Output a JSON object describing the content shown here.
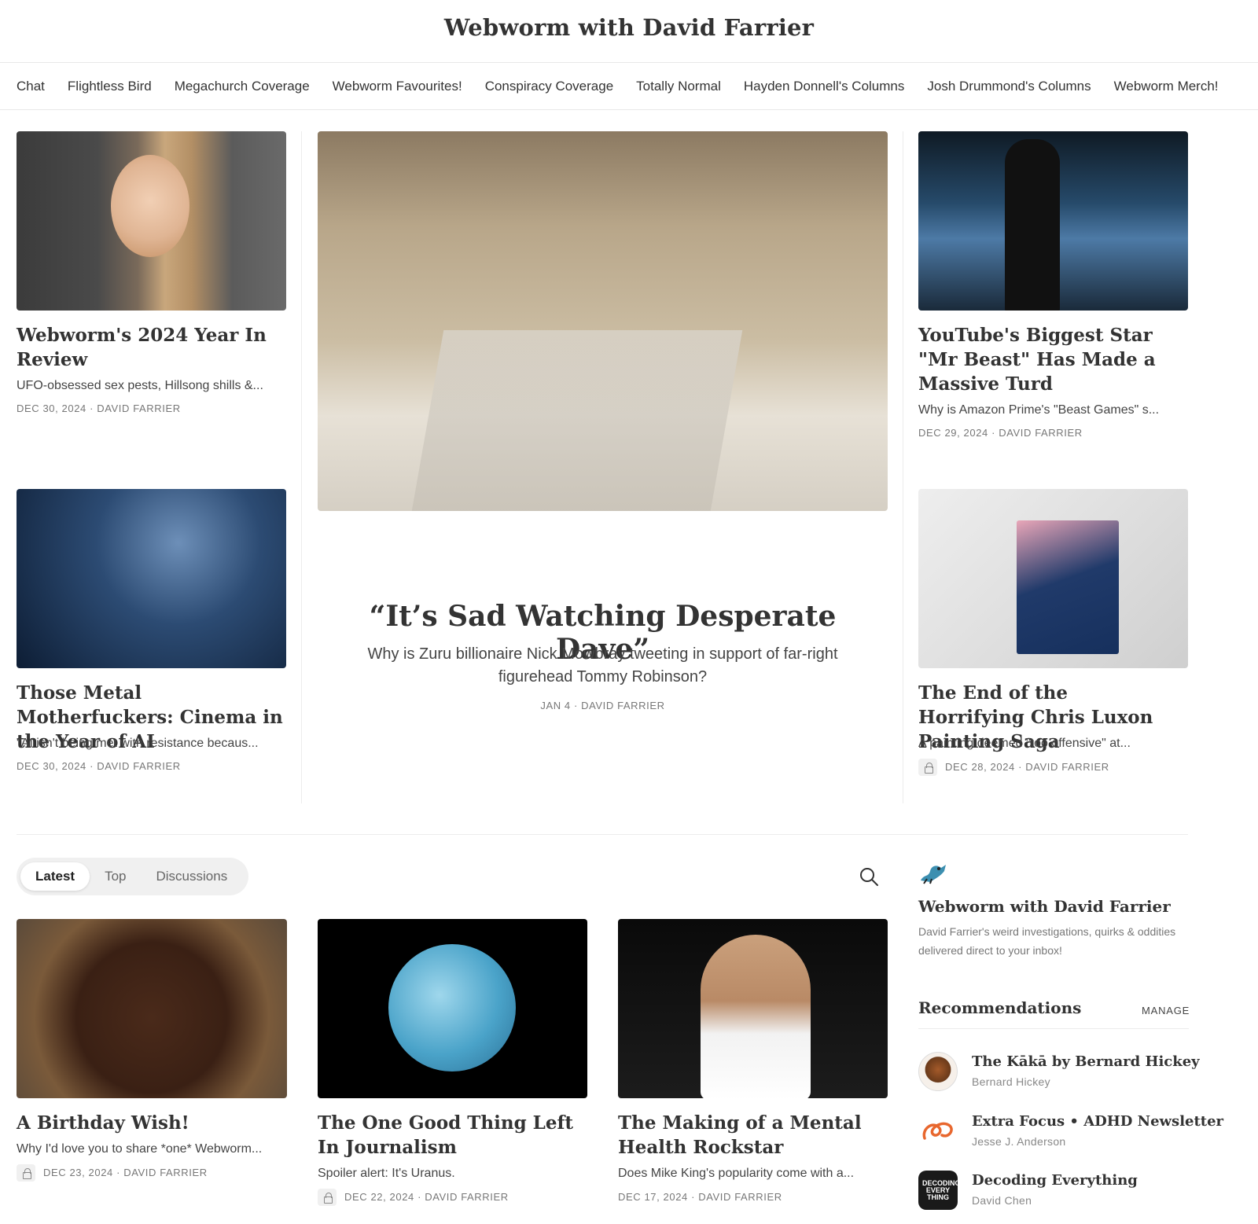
{
  "site": {
    "title": "Webworm with David Farrier"
  },
  "nav": [
    "Chat",
    "Flightless Bird",
    "Megachurch Coverage",
    "Webworm Favourites!",
    "Conspiracy Coverage",
    "Totally Normal",
    "Hayden Donnell's Columns",
    "Josh Drummond's Columns",
    "Webworm Merch!"
  ],
  "featured": {
    "left_top": {
      "title": "Webworm's 2024 Year In Review",
      "subtitle": "UFO-obsessed sex pests, Hillsong shills &...",
      "meta": "DEC 30, 2024 · DAVID FARRIER"
    },
    "left_bottom": {
      "title": "Those Metal Motherfuckers: Cinema in the Year of AI",
      "subtitle": "\"AI isn't being met with resistance becaus...",
      "meta": "DEC 30, 2024 · DAVID FARRIER"
    },
    "center": {
      "title": "“It’s Sad Watching Desperate Dave”",
      "subtitle": "Why is Zuru billionaire Nick Mowbray tweeting in support of far-right figurehead Tommy Robinson?",
      "meta": "JAN 4 · DAVID FARRIER"
    },
    "right_top": {
      "title": "YouTube's Biggest Star \"Mr Beast\" Has Made a Massive Turd",
      "subtitle": "Why is Amazon Prime's \"Beast Games\" s...",
      "meta": "DEC 29, 2024 · DAVID FARRIER"
    },
    "right_bottom": {
      "title": "The End of the Horrifying Chris Luxon Painting Saga",
      "subtitle": "A painting deemed \"too offensive\" at...",
      "meta": "DEC 28, 2024 · DAVID FARRIER"
    }
  },
  "tabs": {
    "latest": "Latest",
    "top": "Top",
    "discussions": "Discussions"
  },
  "posts": [
    {
      "title": "A Birthday Wish!",
      "subtitle": "Why I'd love you to share *one* Webworm...",
      "meta": "DEC 23, 2024 · DAVID FARRIER"
    },
    {
      "title": "The One Good Thing Left In Journalism",
      "subtitle": "Spoiler alert: It's Uranus.",
      "meta": "DEC 22, 2024 · DAVID FARRIER"
    },
    {
      "title": "The Making of a Mental Health Rockstar",
      "subtitle": "Does Mike King's popularity come with a...",
      "meta": "DEC 17, 2024 · DAVID FARRIER"
    }
  ],
  "sidebar": {
    "title": "Webworm with David Farrier",
    "description": "David Farrier's weird investigations, quirks & oddities delivered direct to your inbox!",
    "recommendations_heading": "Recommendations",
    "manage_label": "MANAGE",
    "recommendations": [
      {
        "name": "The Kākā by Bernard Hickey",
        "author": "Bernard Hickey"
      },
      {
        "name": "Extra Focus • ADHD Newsletter",
        "author": "Jesse J. Anderson"
      },
      {
        "name": "Decoding Everything",
        "author": "David Chen",
        "logo_text": "DECODING EVERY THING"
      }
    ]
  },
  "colors": {
    "accent": "#333333",
    "muted": "#777777",
    "divider": "#ececec"
  }
}
